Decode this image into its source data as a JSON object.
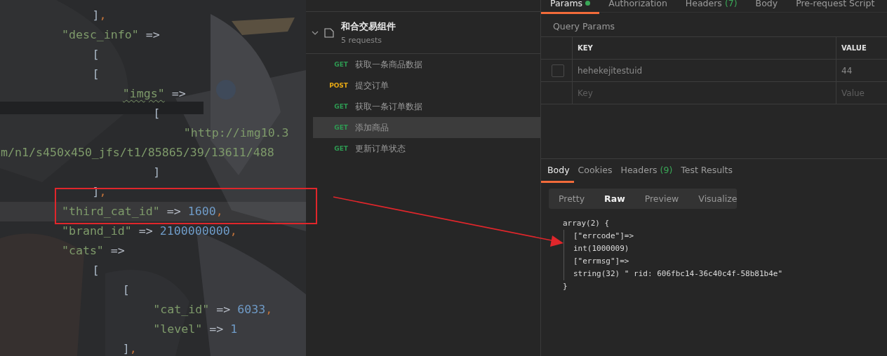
{
  "editor": {
    "lines": [
      {
        "current": false,
        "tokens": [
          {
            "kind": "punc",
            "text": "\t\t\t]"
          },
          {
            "kind": "comma",
            "text": ","
          }
        ]
      },
      {
        "current": false,
        "tokens": [
          {
            "kind": "str",
            "text": "\t\t\"desc_info\""
          },
          {
            "kind": "op",
            "text": " =>"
          }
        ]
      },
      {
        "current": false,
        "tokens": [
          {
            "kind": "punc",
            "text": "\t\t\t["
          }
        ]
      },
      {
        "current": false,
        "tokens": [
          {
            "kind": "punc",
            "text": "\t\t\t["
          }
        ]
      },
      {
        "current": false,
        "tokens": [
          {
            "kind": "str-warn",
            "text": "\t\t\t\t\"imgs\""
          },
          {
            "kind": "op",
            "text": " =>"
          }
        ]
      },
      {
        "current": false,
        "tokens": [
          {
            "kind": "punc",
            "text": "\t\t\t\t\t["
          }
        ]
      },
      {
        "current": false,
        "tokens": [
          {
            "kind": "str",
            "text": "\t\t\t\t\t\t\"http://img10.3"
          }
        ]
      },
      {
        "current": false,
        "tokens": [
          {
            "kind": "str",
            "text": "m/n1/s450x450_jfs/t1/85865/39/13611/488"
          }
        ]
      },
      {
        "current": false,
        "tokens": [
          {
            "kind": "punc",
            "text": "\t\t\t\t\t]"
          }
        ]
      },
      {
        "current": false,
        "tokens": [
          {
            "kind": "punc",
            "text": "\t\t\t]"
          },
          {
            "kind": "comma",
            "text": ","
          }
        ]
      },
      {
        "current": true,
        "tokens": [
          {
            "kind": "str",
            "text": "\t\t\"third_cat_id\""
          },
          {
            "kind": "op",
            "text": " => "
          },
          {
            "kind": "num",
            "text": "1600"
          },
          {
            "kind": "comma",
            "text": ","
          }
        ]
      },
      {
        "current": false,
        "tokens": [
          {
            "kind": "str",
            "text": "\t\t\"brand_id\""
          },
          {
            "kind": "op",
            "text": " => "
          },
          {
            "kind": "num",
            "text": "2100000000"
          },
          {
            "kind": "comma",
            "text": ","
          }
        ]
      },
      {
        "current": false,
        "tokens": [
          {
            "kind": "str",
            "text": "\t\t\"cats\""
          },
          {
            "kind": "op",
            "text": " =>"
          }
        ]
      },
      {
        "current": false,
        "tokens": [
          {
            "kind": "punc",
            "text": "\t\t\t["
          }
        ]
      },
      {
        "current": false,
        "tokens": [
          {
            "kind": "punc",
            "text": "\t\t\t\t["
          }
        ]
      },
      {
        "current": false,
        "tokens": [
          {
            "kind": "str",
            "text": "\t\t\t\t\t\"cat_id\""
          },
          {
            "kind": "op",
            "text": " => "
          },
          {
            "kind": "num",
            "text": "6033"
          },
          {
            "kind": "comma",
            "text": ","
          }
        ]
      },
      {
        "current": false,
        "tokens": [
          {
            "kind": "str",
            "text": "\t\t\t\t\t\"level\""
          },
          {
            "kind": "op",
            "text": " => "
          },
          {
            "kind": "num",
            "text": "1"
          }
        ]
      },
      {
        "current": false,
        "tokens": [
          {
            "kind": "punc",
            "text": "\t\t\t\t]"
          },
          {
            "kind": "comma",
            "text": ","
          }
        ]
      }
    ]
  },
  "collection": {
    "name": "和合交易组件",
    "count": "5 requests",
    "expanded": true,
    "requests": [
      {
        "method": "GET",
        "name": "获取一条商品数据",
        "selected": false
      },
      {
        "method": "POST",
        "name": "提交订单",
        "selected": false
      },
      {
        "method": "GET",
        "name": "获取一条订单数据",
        "selected": false
      },
      {
        "method": "GET",
        "name": "添加商品",
        "selected": true
      },
      {
        "method": "GET",
        "name": "更新订单状态",
        "selected": false
      }
    ]
  },
  "request_tabs": [
    {
      "label": "Params",
      "dot": true,
      "selected": true
    },
    {
      "label": "Authorization",
      "dot": false,
      "selected": false
    },
    {
      "label": "Headers",
      "count": "(7)",
      "dot": false,
      "selected": false
    },
    {
      "label": "Body",
      "dot": false,
      "selected": false
    },
    {
      "label": "Pre-request Script",
      "dot": false,
      "selected": false
    }
  ],
  "query_params": {
    "title": "Query Params",
    "columns": [
      "KEY",
      "VALUE"
    ],
    "rows": [
      {
        "key": "hehekejitestuid",
        "value": "44",
        "checked": false
      }
    ],
    "new_row": {
      "key_placeholder": "Key",
      "value_placeholder": "Value"
    }
  },
  "response_tabs": [
    {
      "label": "Body",
      "selected": true
    },
    {
      "label": "Cookies",
      "selected": false
    },
    {
      "label": "Headers",
      "count": "(9)",
      "selected": false
    },
    {
      "label": "Test Results",
      "selected": false
    }
  ],
  "formats": [
    {
      "label": "Pretty",
      "selected": false
    },
    {
      "label": "Raw",
      "selected": true
    },
    {
      "label": "Preview",
      "selected": false
    },
    {
      "label": "Visualize",
      "selected": false
    }
  ],
  "response_body": {
    "open": "array(2) {",
    "lines": [
      "[\"errcode\"]=>",
      "int(1000009)",
      "[\"errmsg\"]=>",
      "string(32) \" rid: 606fbc14-36c40c4f-58b81b4e\""
    ],
    "close": "}"
  }
}
